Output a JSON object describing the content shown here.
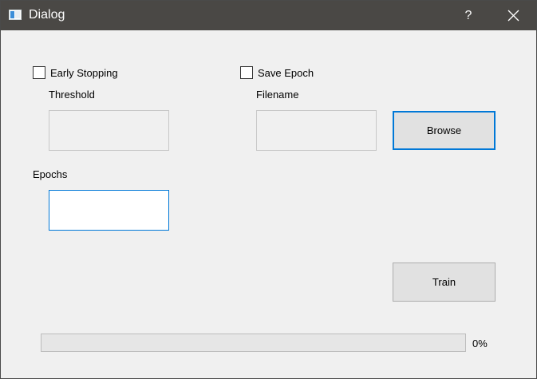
{
  "window": {
    "title": "Dialog",
    "help_label": "?",
    "close_label": "×"
  },
  "early_stopping": {
    "label": "Early Stopping",
    "checked": false,
    "threshold_label": "Threshold",
    "threshold_value": ""
  },
  "save_epoch": {
    "label": "Save Epoch",
    "checked": false,
    "filename_label": "Filename",
    "filename_value": ""
  },
  "browse_label": "Browse",
  "epochs": {
    "label": "Epochs",
    "value": ""
  },
  "train_label": "Train",
  "progress": {
    "value": 0,
    "text": "0%"
  },
  "colors": {
    "titlebar": "#4a4845",
    "accent": "#0078d7",
    "background": "#f0f0f0"
  }
}
